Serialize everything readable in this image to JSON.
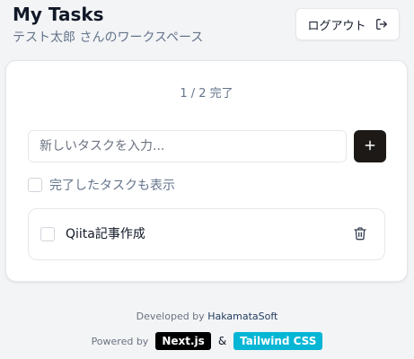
{
  "header": {
    "title": "My Tasks",
    "subtitle": "テスト太郎 さんのワークスペース",
    "logout_label": "ログアウト"
  },
  "main": {
    "progress": "1 / 2 完了",
    "new_task_placeholder": "新しいタスクを入力...",
    "show_completed_label": "完了したタスクも表示",
    "show_completed_checked": false,
    "tasks": [
      {
        "title": "Qiita記事作成",
        "completed": false
      }
    ]
  },
  "footer": {
    "developed_by_prefix": "Developed by",
    "developer": "HakamataSoft",
    "powered_by": "Powered by",
    "badges": [
      "Next.js",
      "Tailwind CSS"
    ],
    "ampersand": "&"
  },
  "colors": {
    "primary_button": "#1c1917",
    "tailwind_badge": "#06b6d4",
    "next_badge": "#000000",
    "muted_text": "#64748b"
  },
  "icons": [
    "logout-icon",
    "plus-icon",
    "trash-icon"
  ]
}
